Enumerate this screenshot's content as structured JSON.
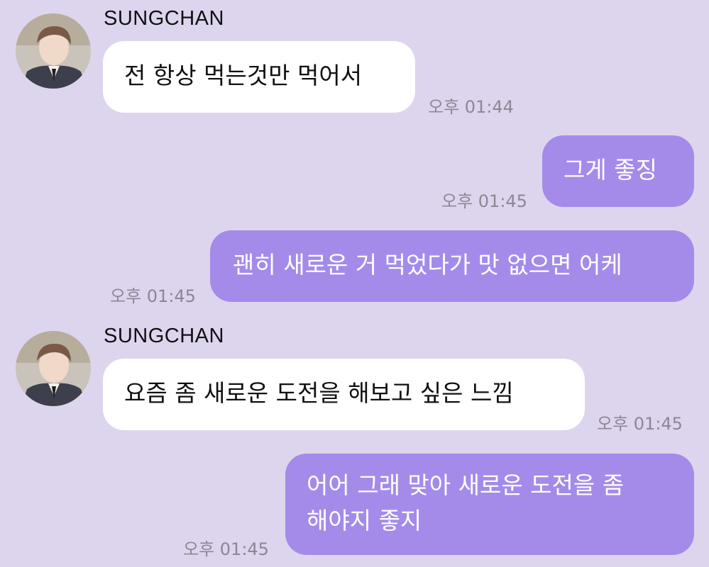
{
  "chat": {
    "messages": [
      {
        "direction": "in",
        "sender": "SUNGCHAN",
        "lines": [
          "전 항상 먹는것만 먹어서"
        ],
        "time": "오후 01:44"
      },
      {
        "direction": "out",
        "lines": [
          "그게 좋징"
        ],
        "time": "오후 01:45"
      },
      {
        "direction": "out",
        "lines": [
          "괜히 새로운 거 먹었다가 맛 없으면 어케"
        ],
        "time": "오후 01:45"
      },
      {
        "direction": "in",
        "sender": "SUNGCHAN",
        "lines": [
          "요즘 좀 새로운 도전을 해보고 싶은 느낌"
        ],
        "time": "오후 01:45"
      },
      {
        "direction": "out",
        "lines": [
          "어어 그래 맞아 새로운 도전을 좀",
          "해야지 좋지"
        ],
        "time": "오후 01:45"
      }
    ]
  },
  "colors": {
    "background": "#ddd5ee",
    "incoming_bubble": "#ffffff",
    "outgoing_bubble": "#a48bea",
    "timestamp": "#8c8794"
  }
}
